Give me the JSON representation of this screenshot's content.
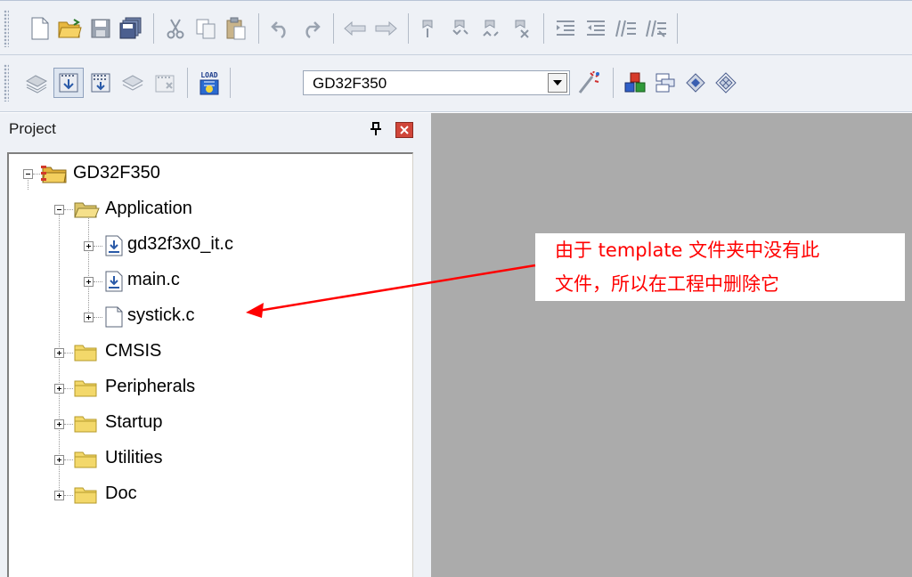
{
  "toolbar_row1": {
    "buttons": [
      "new-file-icon",
      "open-file-icon",
      "save-icon",
      "save-all-icon",
      "cut-icon",
      "copy-icon",
      "paste-icon",
      "undo-icon",
      "redo-icon",
      "navigate-back-icon",
      "navigate-forward-icon",
      "bookmark-insert-icon",
      "bookmark-prev-icon",
      "bookmark-next-icon",
      "bookmark-clear-icon",
      "indent-icon",
      "unindent-icon",
      "comment-icon",
      "uncomment-icon"
    ]
  },
  "toolbar_row2": {
    "buttons": [
      "translate-icon",
      "build-icon",
      "rebuild-icon",
      "batch-build-icon",
      "stop-build-icon",
      "download-load-icon"
    ],
    "load_label": "LOAD",
    "target_combo": {
      "value": "GD32F350"
    },
    "right_buttons": [
      "target-options-icon",
      "manage-components-icon",
      "select-packs-icon",
      "software-packs-icon",
      "pack-installer-icon"
    ]
  },
  "project_panel": {
    "title": "Project",
    "tree": {
      "root": "GD32F350",
      "application": {
        "label": "Application",
        "files": [
          "gd32f3x0_it.c",
          "main.c",
          "systick.c"
        ]
      },
      "groups": [
        "CMSIS",
        "Peripherals",
        "Startup",
        "Utilities",
        "Doc"
      ]
    }
  },
  "annotation": {
    "line1": "由于 template 文件夹中没有此",
    "line2": "文件，所以在工程中删除它",
    "color": "#ff0000"
  },
  "colors": {
    "toolbar_bg": "#eef1f6",
    "editor_bg": "#ababab",
    "annotation_red": "#ff0000",
    "folder_yellow": "#f3d86a"
  }
}
